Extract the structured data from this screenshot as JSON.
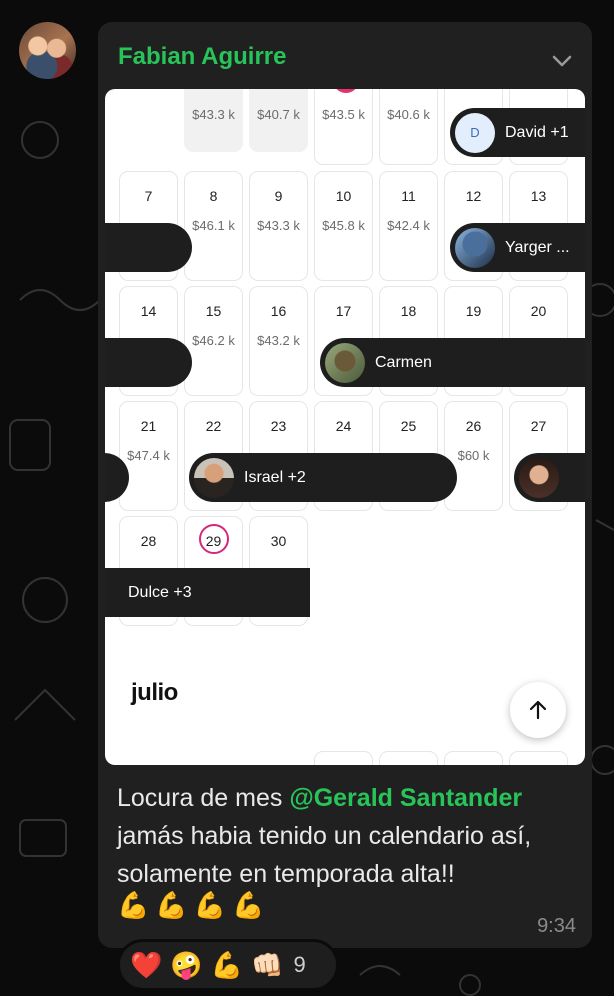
{
  "message": {
    "sender": "Fabian Aguirre",
    "caption_before": "Locura de mes ",
    "mention": "@Gerald Santander",
    "caption_after": " jamás habia tenido un calendario así, solamente en temporada alta!!",
    "emojis": [
      "💪",
      "💪",
      "💪",
      "💪"
    ],
    "time": "9:34"
  },
  "calendar": {
    "top_row_prices": [
      "$43.3 k",
      "$40.7 k",
      "$43.5 k",
      "$40.6 k"
    ],
    "week2": {
      "days": [
        "7",
        "8",
        "9",
        "10",
        "11",
        "12",
        "13"
      ],
      "prices": [
        "",
        "$46.1 k",
        "$43.3 k",
        "$45.8 k",
        "$42.4 k",
        "",
        ""
      ]
    },
    "week3": {
      "days": [
        "14",
        "15",
        "16",
        "17",
        "18",
        "19",
        "20"
      ],
      "prices": [
        "",
        "$46.2 k",
        "$43.2 k",
        "",
        "",
        "",
        ""
      ]
    },
    "week4": {
      "days": [
        "21",
        "22",
        "23",
        "24",
        "25",
        "26",
        "27"
      ],
      "prices": [
        "$47.4 k",
        "",
        "",
        "",
        "",
        "$60 k",
        ""
      ]
    },
    "week5": {
      "days": [
        "28",
        "29",
        "30"
      ]
    },
    "bookings": {
      "david": {
        "initial": "D",
        "label": "David +1"
      },
      "yarger": {
        "label": "Yarger ..."
      },
      "carmen": {
        "label": "Carmen"
      },
      "israel": {
        "label": "Israel +2"
      },
      "dulce": {
        "label": "Dulce +3"
      }
    },
    "next_month": "julio"
  },
  "reactions": {
    "emojis": [
      "❤️",
      "🤪",
      "💪",
      "👊🏻"
    ],
    "count": "9"
  },
  "colors": {
    "accent": "#28c45a",
    "bubble": "#202020",
    "today": "#d5287b"
  }
}
